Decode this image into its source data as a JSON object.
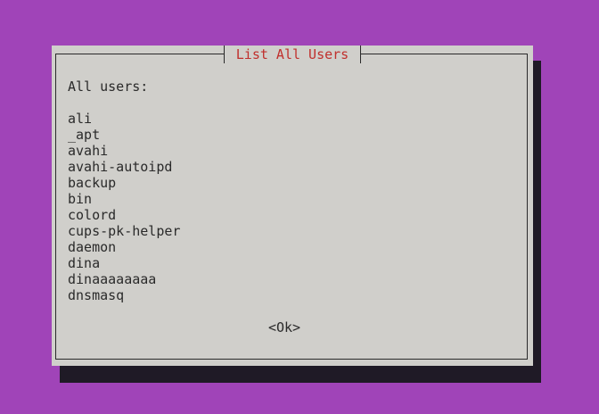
{
  "dialog": {
    "title": "List All Users",
    "heading": "All users:",
    "users": [
      "ali",
      "_apt",
      "avahi",
      "avahi-autoipd",
      "backup",
      "bin",
      "colord",
      "cups-pk-helper",
      "daemon",
      "dina",
      "dinaaaaaaaa",
      "dnsmasq"
    ],
    "ok_label": "<Ok>"
  },
  "colors": {
    "background": "#a044b8",
    "dialog_background": "#d0cfcb",
    "title_text": "#c0302d",
    "text": "#2a2a2a",
    "shadow": "#1f1a26"
  }
}
